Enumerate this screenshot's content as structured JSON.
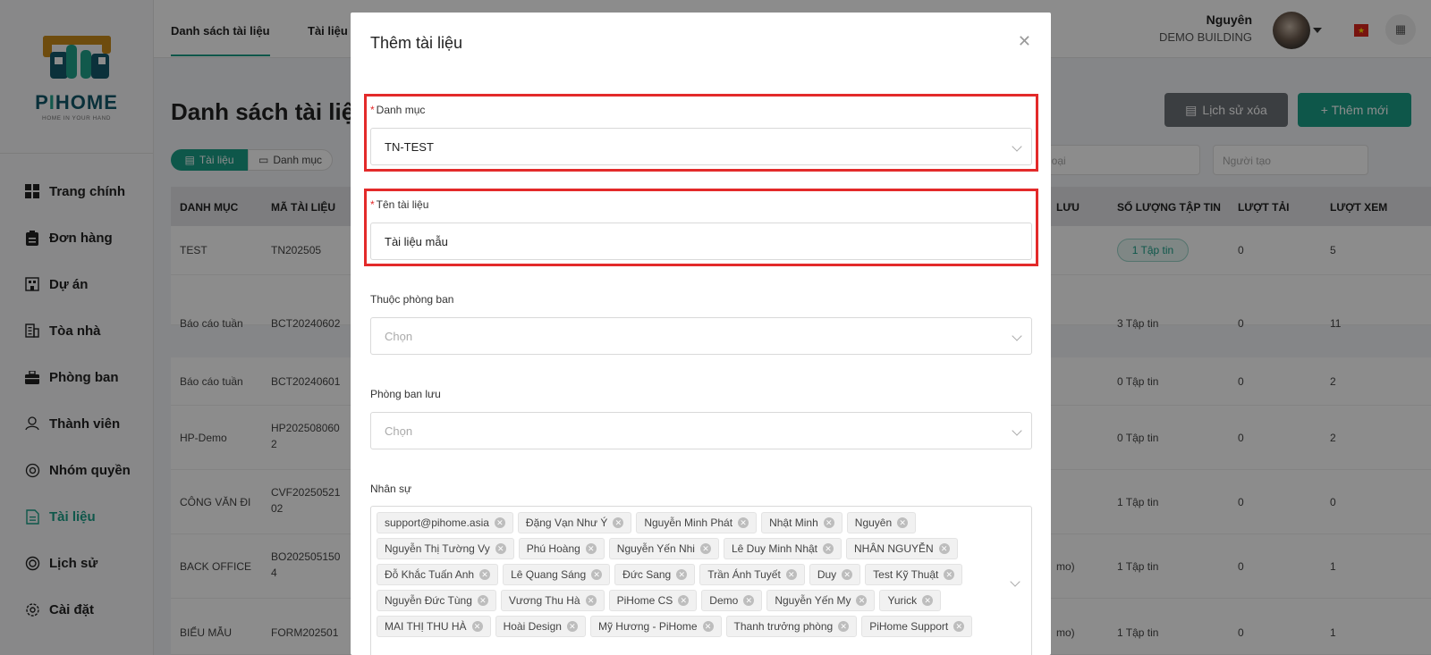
{
  "brand": {
    "name_pre": "P",
    "name_i": "I",
    "name_post": "HOME",
    "tagline": "HOME IN YOUR HAND"
  },
  "sidebar": {
    "items": [
      {
        "label": "Trang chính",
        "icon": "grid-icon"
      },
      {
        "label": "Đơn hàng",
        "icon": "clipboard-icon"
      },
      {
        "label": "Dự án",
        "icon": "building-icon"
      },
      {
        "label": "Tòa nhà",
        "icon": "office-icon"
      },
      {
        "label": "Phòng ban",
        "icon": "briefcase-icon"
      },
      {
        "label": "Thành viên",
        "icon": "user-icon"
      },
      {
        "label": "Nhóm quyền",
        "icon": "settings-icon"
      },
      {
        "label": "Tài liệu",
        "icon": "document-icon"
      },
      {
        "label": "Lịch sử",
        "icon": "history-icon"
      },
      {
        "label": "Cài đặt",
        "icon": "gear-icon"
      }
    ],
    "active_index": 7
  },
  "topbar": {
    "tab_list": "Danh sách tài liệu",
    "tab_other": "Tài liệu",
    "user_name": "Nguyên",
    "building": "DEMO BUILDING"
  },
  "page": {
    "title": "Danh sách tài liệu",
    "history_button": "Lịch sử xóa",
    "add_button": "+ Thêm mới",
    "chip_docs": "Tài liệu",
    "chip_category": "Danh mục",
    "filter_type": "loại",
    "filter_creator": "Người tạo"
  },
  "table": {
    "headers": [
      "DANH MỤC",
      "MÃ TÀI LIỆU",
      "LƯU",
      "SỐ LƯỢNG TẬP TIN",
      "LƯỢT TẢI",
      "LƯỢT XEM"
    ],
    "rows": [
      {
        "category": "TEST",
        "code": "TN202505",
        "store": "",
        "files": "1 Tập tin",
        "downloads": "0",
        "views": "5"
      },
      {
        "category": "Báo cáo tuần",
        "code": "BCT20240602",
        "store": "",
        "files": "3 Tập tin",
        "downloads": "0",
        "views": "11"
      },
      {
        "category": "Báo cáo tuần",
        "code": "BCT20240601",
        "store": "",
        "files": "0 Tập tin",
        "downloads": "0",
        "views": "2"
      },
      {
        "category": "HP-Demo",
        "code": "HP202508060\n2",
        "store": "",
        "files": "0 Tập tin",
        "downloads": "0",
        "views": "2"
      },
      {
        "category": "CÔNG VĂN ĐI",
        "code": "CVF20250521\n02",
        "store": "",
        "files": "1 Tập tin",
        "downloads": "0",
        "views": "0"
      },
      {
        "category": "BACK OFFICE",
        "code": "BO202505150\n4",
        "store": "mo)",
        "files": "1 Tập tin",
        "downloads": "0",
        "views": "1"
      },
      {
        "category": "BIỂU MẪU",
        "code": "FORM202501",
        "store": "mo)",
        "files": "1 Tập tin",
        "downloads": "0",
        "views": "1"
      }
    ]
  },
  "modal": {
    "title": "Thêm tài liệu",
    "category_label": "Danh mục",
    "category_value": "TN-TEST",
    "name_label": "Tên tài liệu",
    "name_value": "Tài liệu mẫu",
    "department_label": "Thuộc phòng ban",
    "department_placeholder": "Chọn",
    "storage_dept_label": "Phòng ban lưu",
    "storage_dept_placeholder": "Chọn",
    "staff_label": "Nhân sự",
    "staff": [
      "support@pihome.asia",
      "Đặng Vạn Như Ý",
      "Nguyễn Minh Phát",
      "Nhật Minh",
      "Nguyên",
      "Nguyễn Thị Tường Vy",
      "Phú Hoàng",
      "Nguyễn Yến Nhi",
      "Lê Duy Minh Nhật",
      "NHÂN NGUYỄN",
      "Đỗ Khắc Tuấn Anh",
      "Lê Quang Sáng",
      "Đức Sang",
      "Trần Ánh Tuyết",
      "Duy",
      "Test Kỹ Thuật",
      "Nguyễn Đức Tùng",
      "Vương Thu Hà",
      "PiHome CS",
      "Demo",
      "Nguyễn Yến My",
      "Yurick",
      "MAI THỊ THU HÀ",
      "Hoài Design",
      "Mỹ Hương - PiHome",
      "Thanh trưởng phòng",
      "PiHome Support"
    ]
  },
  "colors": {
    "accent": "#1a9e88",
    "highlight": "#e32a2a",
    "overlay": "rgba(0,0,0,0.45)"
  }
}
